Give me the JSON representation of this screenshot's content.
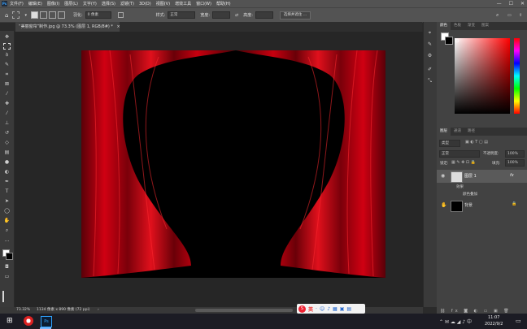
{
  "menu": {
    "items": [
      "文件(F)",
      "编辑(E)",
      "图像(I)",
      "图层(L)",
      "文字(Y)",
      "选择(S)",
      "滤镜(T)",
      "3D(D)",
      "视图(V)",
      "增效工具",
      "窗口(W)",
      "帮助(H)"
    ],
    "logo": "Ps"
  },
  "options": {
    "feather_label": "羽化:",
    "feather_value": "0 像素",
    "style_label": "样式:",
    "style_value": "正常",
    "width_label": "宽度:",
    "height_label": "高度:",
    "select_mask_button": "选择并遮住 ..."
  },
  "document": {
    "tab_title": "“美丽窗帘”制作.jpg @ 73.3% (图层 1, RGB/8#) *",
    "close": "×"
  },
  "status": {
    "zoom": "73.32%",
    "size": "1134 像素 x 890 像素 (72 ppi)"
  },
  "color_panel": {
    "tabs": [
      "颜色",
      "色板",
      "渐变",
      "图案"
    ],
    "active_tab": 0
  },
  "layers_panel": {
    "tabs": [
      "图层",
      "通道",
      "路径"
    ],
    "active_tab": 0,
    "filter_label": "类型",
    "blend_mode": "正常",
    "opacity_label": "不透明度:",
    "opacity_value": "100%",
    "lock_label": "锁定:",
    "fill_label": "填充:",
    "fill_value": "100%",
    "layers": [
      {
        "name": "图层 1",
        "fx": "fx"
      },
      {
        "name": "背景"
      }
    ],
    "effects_label": "效果",
    "effect_item": "颜色叠加"
  },
  "ime": {
    "label": "英"
  },
  "taskbar": {
    "time": "11:07",
    "date": "2022/9/2"
  },
  "colors": {
    "curtain_red": "#c4000e",
    "curtain_dark": "#4a0005",
    "canvas_bg": "#000000"
  }
}
